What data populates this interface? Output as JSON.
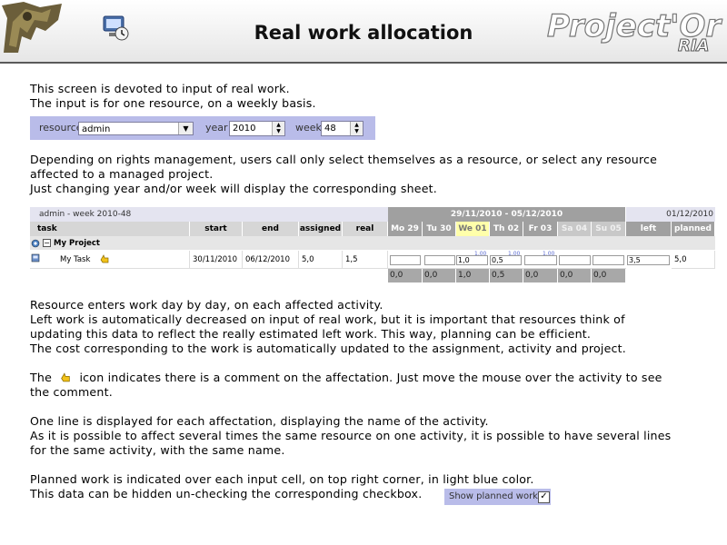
{
  "header": {
    "title": "Real work allocation",
    "brand_main": "Project'Or",
    "brand_sub": "RIA",
    "icon": "screen-icon"
  },
  "intro": [
    "This screen is devoted to input of real work.",
    "The input is for one resource, on a weekly basis."
  ],
  "selector": {
    "resource_label": "resource",
    "resource_value": "admin",
    "year_label": "year",
    "year_value": "2010",
    "week_label": "week",
    "week_value": "48"
  },
  "para2": [
    "Depending on rights management, users call only select themselves as a resource, or select any resource",
    "affected to a managed project.",
    "Just changing year and/or week will display the corresponding sheet."
  ],
  "grid": {
    "caption": "admin - week 2010-48",
    "period": "29/11/2010 - 05/12/2010",
    "today_date": "01/12/2010",
    "columns": {
      "task": "task",
      "start": "start",
      "end": "end",
      "assigned": "assigned",
      "real": "real",
      "left": "left",
      "planned": "planned"
    },
    "days": [
      "Mo 29",
      "Tu 30",
      "We 01",
      "Th 02",
      "Fr 03",
      "Sa 04",
      "Su 05"
    ],
    "project": {
      "toggle": "−",
      "name": "My Project"
    },
    "task": {
      "name": "My Task",
      "start": "30/11/2010",
      "end": "06/12/2010",
      "assigned": "5,0",
      "real": "1,5",
      "day_values": [
        "",
        "",
        "1,0",
        "0,5",
        "",
        "",
        ""
      ],
      "planned_values": [
        "",
        "",
        "1.00",
        "1.00",
        "1.00",
        "",
        ""
      ],
      "left": "3,5",
      "planned": "5,0"
    },
    "totals": [
      "0,0",
      "0,0",
      "1,0",
      "0,5",
      "0,0",
      "0,0",
      "0,0"
    ]
  },
  "para3": [
    "Resource enters work day by day, on each affected activity.",
    "Left work is automatically decreased on input of real work, but it is important that resources think of",
    "updating this data to reflect the really estimated left work. This way, planning can be efficient.",
    "The cost corresponding to the work is automatically updated to the assignment, activity and project."
  ],
  "para4": {
    "before": "The",
    "after": "icon indicates there is a comment on the affectation. Just move the mouse over the activity to see",
    "line2": "the comment."
  },
  "para5": [
    "One line is displayed for each affectation, displaying the name of the activity.",
    "As it is possible to affect several times the same resource on one activity, it is possible to have several lines",
    "for the same activity, with the same name."
  ],
  "para6": [
    "Planned work is indicated over each input cell, on top right corner, in light blue color.",
    "This data can be hidden un-checking the corresponding checkbox."
  ],
  "show_planned": {
    "label": "Show planned work",
    "checked": "✓"
  },
  "colors": {
    "accent": "#b9bce9",
    "today": "#ffffaa",
    "planned_text": "#5a6ad0"
  }
}
